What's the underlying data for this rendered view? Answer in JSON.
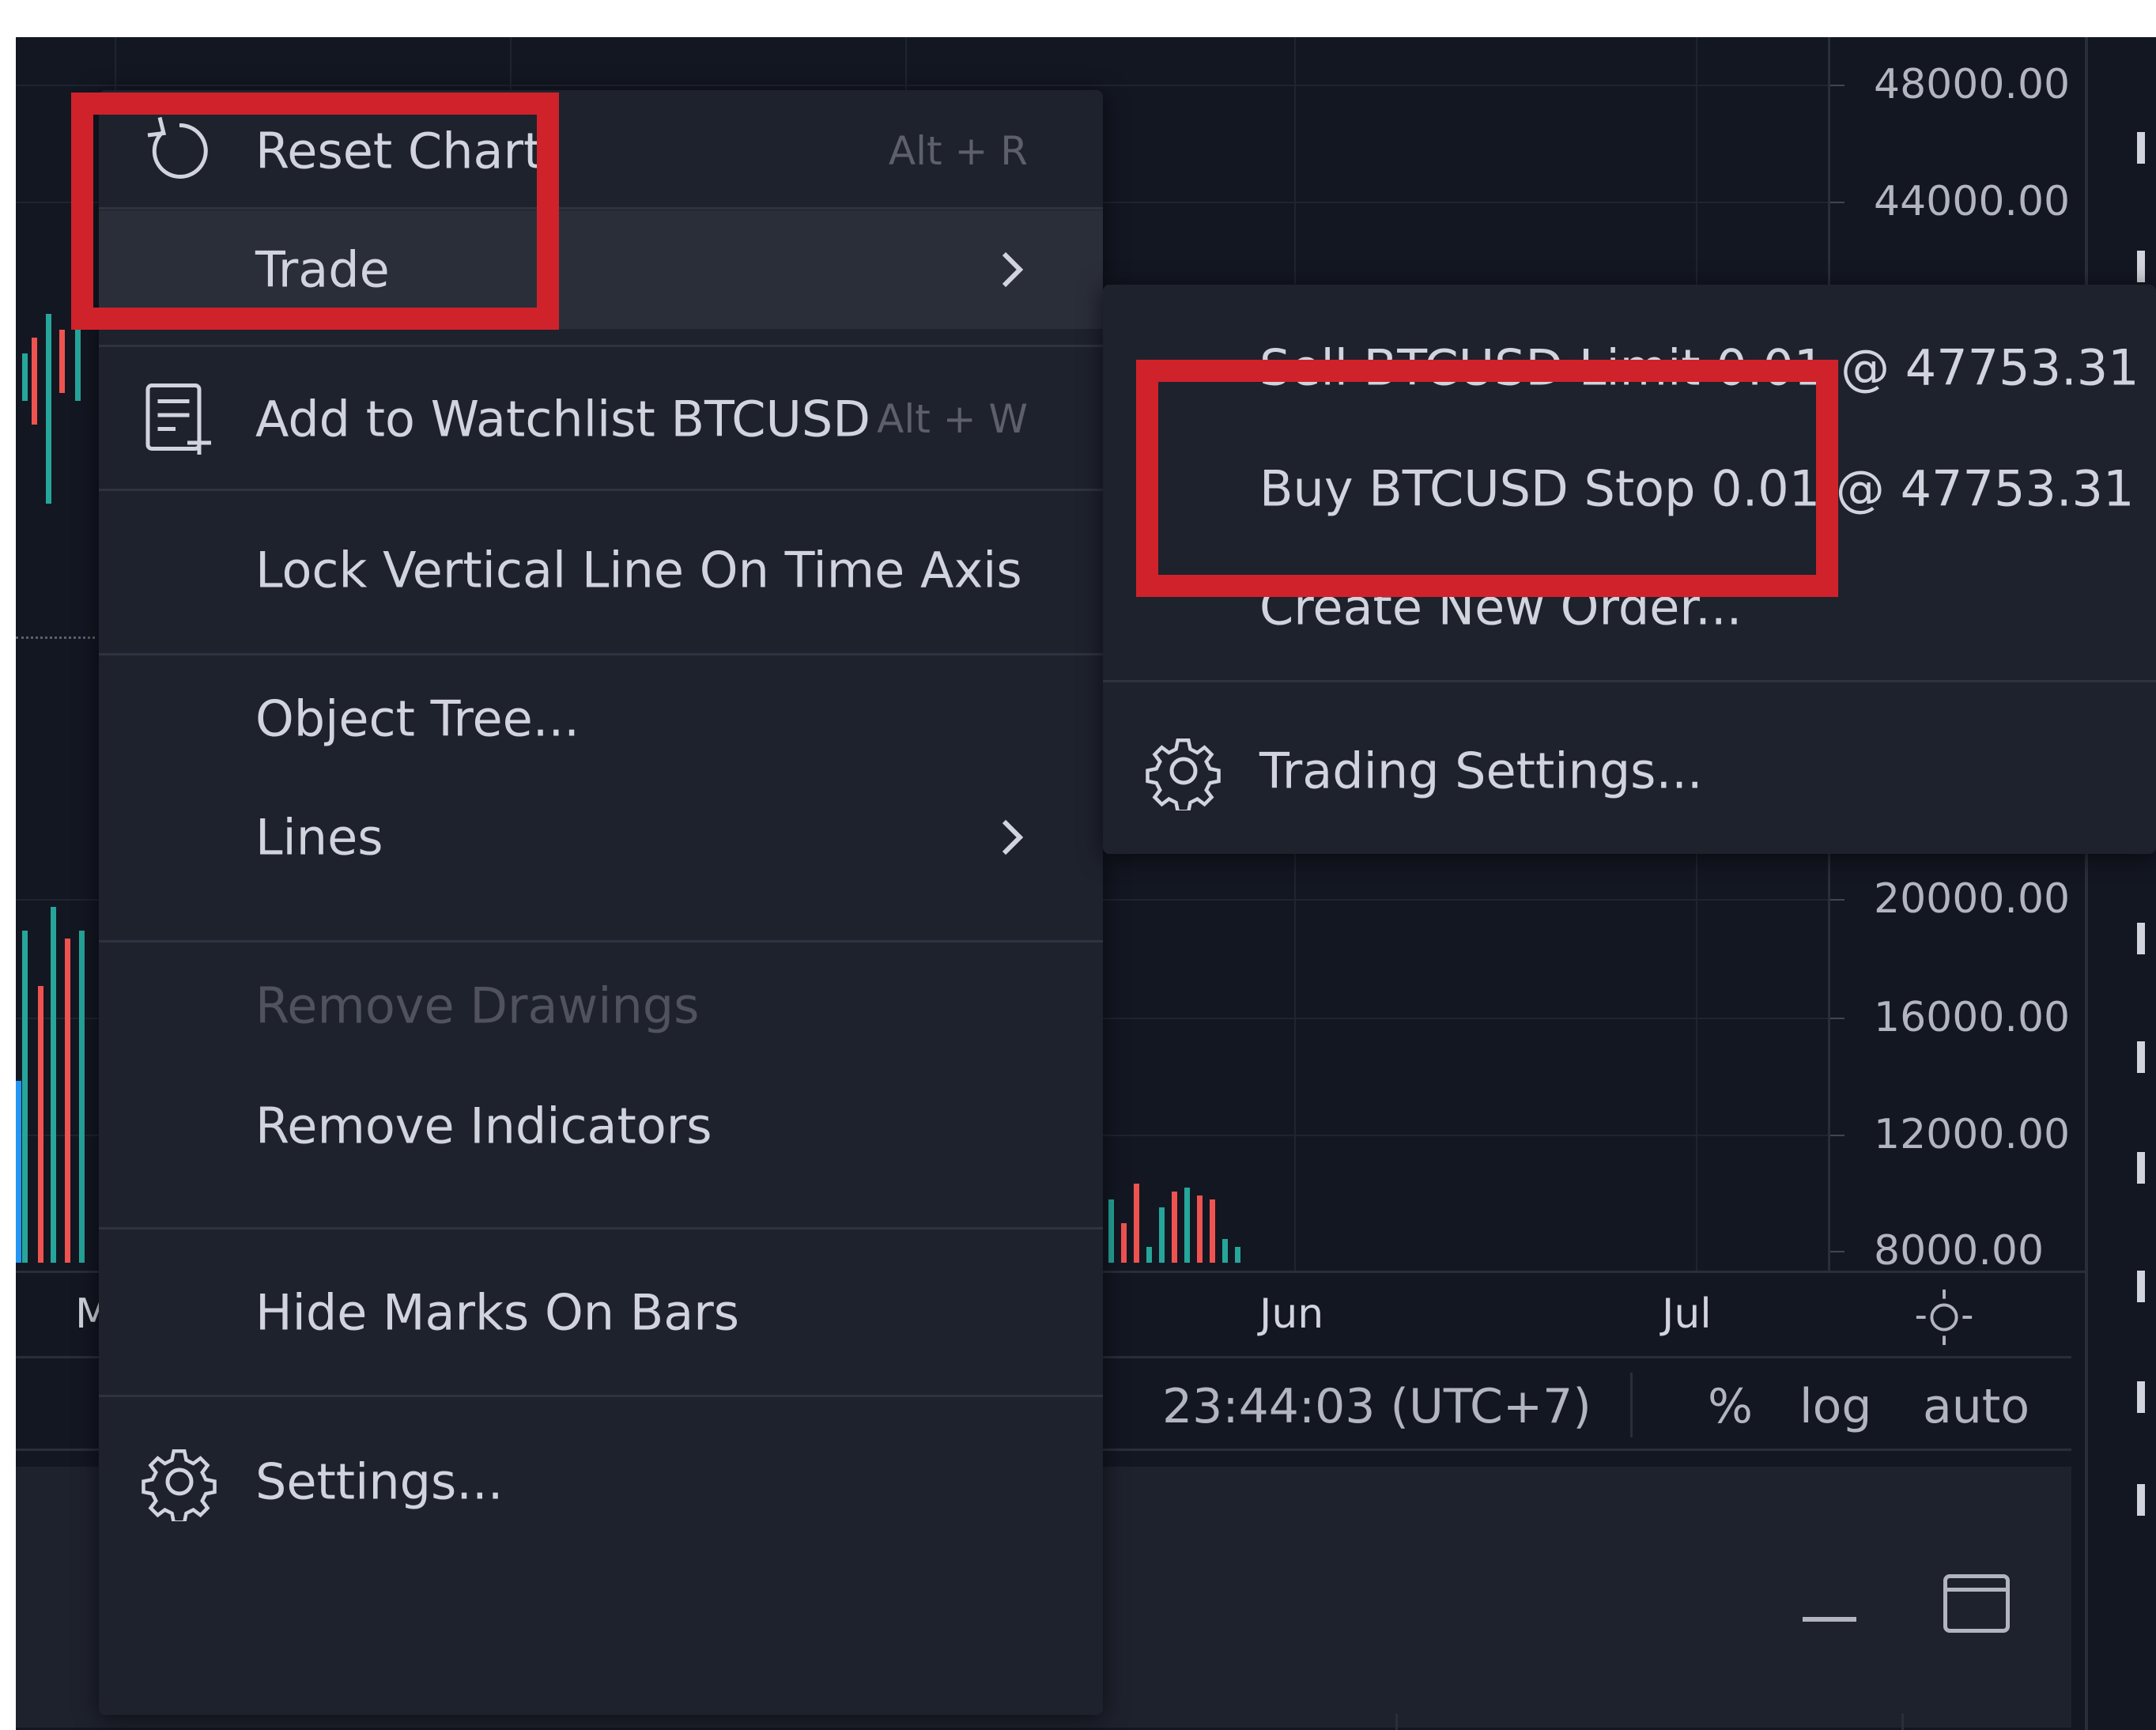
{
  "price_axis": {
    "ticks": [
      "48000.00",
      "44000.00",
      "20000.00",
      "16000.00",
      "12000.00",
      "8000.00"
    ]
  },
  "time_axis": {
    "labels": [
      "M",
      "Jun",
      "Jul"
    ]
  },
  "info_bar": {
    "time": "23:44:03 (UTC+7)",
    "percent": "%",
    "log": "log",
    "auto": "auto"
  },
  "menu": {
    "reset_chart": {
      "label": "Reset Chart",
      "shortcut": "Alt + R",
      "icon": "reset-icon"
    },
    "trade": {
      "label": "Trade"
    },
    "add_watchlist": {
      "label": "Add to Watchlist BTCUSD",
      "shortcut": "Alt + W",
      "icon": "watchlist-add-icon"
    },
    "lock_vertical": {
      "label": "Lock Vertical Line On Time Axis"
    },
    "object_tree": {
      "label": "Object Tree..."
    },
    "lines": {
      "label": "Lines"
    },
    "remove_drawings": {
      "label": "Remove Drawings"
    },
    "remove_indicators": {
      "label": "Remove Indicators"
    },
    "hide_marks": {
      "label": "Hide Marks On Bars"
    },
    "settings": {
      "label": "Settings...",
      "icon": "gear-icon"
    }
  },
  "submenu": {
    "sell_limit": {
      "label": "Sell BTCUSD Limit 0.01 @ 47753.31"
    },
    "buy_stop": {
      "label": "Buy BTCUSD Stop 0.01 @ 47753.31"
    },
    "create_order": {
      "label": "Create New Order..."
    },
    "trading_settings": {
      "label": "Trading Settings...",
      "icon": "gear-icon"
    }
  },
  "colors": {
    "background": "#131722",
    "menu_bg": "#1e222d",
    "menu_hover": "#2a2e39",
    "text": "#d1d4dc",
    "text_disabled": "#50535e",
    "highlight": "#d0222b"
  }
}
